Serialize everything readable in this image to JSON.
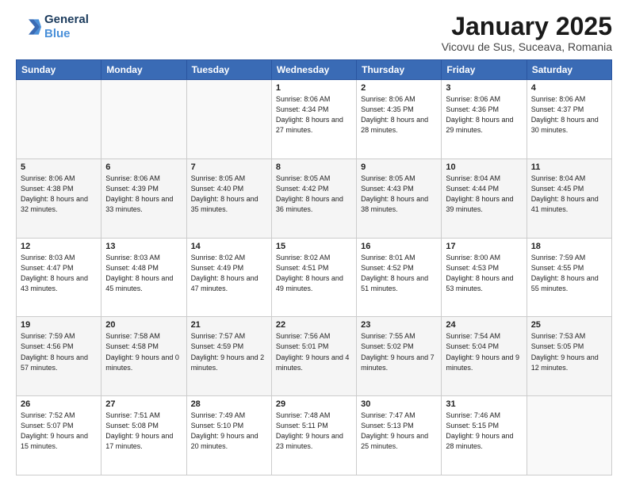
{
  "header": {
    "logo_line1": "General",
    "logo_line2": "Blue",
    "month": "January 2025",
    "location": "Vicovu de Sus, Suceava, Romania"
  },
  "days_of_week": [
    "Sunday",
    "Monday",
    "Tuesday",
    "Wednesday",
    "Thursday",
    "Friday",
    "Saturday"
  ],
  "weeks": [
    [
      {
        "day": "",
        "info": ""
      },
      {
        "day": "",
        "info": ""
      },
      {
        "day": "",
        "info": ""
      },
      {
        "day": "1",
        "info": "Sunrise: 8:06 AM\nSunset: 4:34 PM\nDaylight: 8 hours and 27 minutes."
      },
      {
        "day": "2",
        "info": "Sunrise: 8:06 AM\nSunset: 4:35 PM\nDaylight: 8 hours and 28 minutes."
      },
      {
        "day": "3",
        "info": "Sunrise: 8:06 AM\nSunset: 4:36 PM\nDaylight: 8 hours and 29 minutes."
      },
      {
        "day": "4",
        "info": "Sunrise: 8:06 AM\nSunset: 4:37 PM\nDaylight: 8 hours and 30 minutes."
      }
    ],
    [
      {
        "day": "5",
        "info": "Sunrise: 8:06 AM\nSunset: 4:38 PM\nDaylight: 8 hours and 32 minutes."
      },
      {
        "day": "6",
        "info": "Sunrise: 8:06 AM\nSunset: 4:39 PM\nDaylight: 8 hours and 33 minutes."
      },
      {
        "day": "7",
        "info": "Sunrise: 8:05 AM\nSunset: 4:40 PM\nDaylight: 8 hours and 35 minutes."
      },
      {
        "day": "8",
        "info": "Sunrise: 8:05 AM\nSunset: 4:42 PM\nDaylight: 8 hours and 36 minutes."
      },
      {
        "day": "9",
        "info": "Sunrise: 8:05 AM\nSunset: 4:43 PM\nDaylight: 8 hours and 38 minutes."
      },
      {
        "day": "10",
        "info": "Sunrise: 8:04 AM\nSunset: 4:44 PM\nDaylight: 8 hours and 39 minutes."
      },
      {
        "day": "11",
        "info": "Sunrise: 8:04 AM\nSunset: 4:45 PM\nDaylight: 8 hours and 41 minutes."
      }
    ],
    [
      {
        "day": "12",
        "info": "Sunrise: 8:03 AM\nSunset: 4:47 PM\nDaylight: 8 hours and 43 minutes."
      },
      {
        "day": "13",
        "info": "Sunrise: 8:03 AM\nSunset: 4:48 PM\nDaylight: 8 hours and 45 minutes."
      },
      {
        "day": "14",
        "info": "Sunrise: 8:02 AM\nSunset: 4:49 PM\nDaylight: 8 hours and 47 minutes."
      },
      {
        "day": "15",
        "info": "Sunrise: 8:02 AM\nSunset: 4:51 PM\nDaylight: 8 hours and 49 minutes."
      },
      {
        "day": "16",
        "info": "Sunrise: 8:01 AM\nSunset: 4:52 PM\nDaylight: 8 hours and 51 minutes."
      },
      {
        "day": "17",
        "info": "Sunrise: 8:00 AM\nSunset: 4:53 PM\nDaylight: 8 hours and 53 minutes."
      },
      {
        "day": "18",
        "info": "Sunrise: 7:59 AM\nSunset: 4:55 PM\nDaylight: 8 hours and 55 minutes."
      }
    ],
    [
      {
        "day": "19",
        "info": "Sunrise: 7:59 AM\nSunset: 4:56 PM\nDaylight: 8 hours and 57 minutes."
      },
      {
        "day": "20",
        "info": "Sunrise: 7:58 AM\nSunset: 4:58 PM\nDaylight: 9 hours and 0 minutes."
      },
      {
        "day": "21",
        "info": "Sunrise: 7:57 AM\nSunset: 4:59 PM\nDaylight: 9 hours and 2 minutes."
      },
      {
        "day": "22",
        "info": "Sunrise: 7:56 AM\nSunset: 5:01 PM\nDaylight: 9 hours and 4 minutes."
      },
      {
        "day": "23",
        "info": "Sunrise: 7:55 AM\nSunset: 5:02 PM\nDaylight: 9 hours and 7 minutes."
      },
      {
        "day": "24",
        "info": "Sunrise: 7:54 AM\nSunset: 5:04 PM\nDaylight: 9 hours and 9 minutes."
      },
      {
        "day": "25",
        "info": "Sunrise: 7:53 AM\nSunset: 5:05 PM\nDaylight: 9 hours and 12 minutes."
      }
    ],
    [
      {
        "day": "26",
        "info": "Sunrise: 7:52 AM\nSunset: 5:07 PM\nDaylight: 9 hours and 15 minutes."
      },
      {
        "day": "27",
        "info": "Sunrise: 7:51 AM\nSunset: 5:08 PM\nDaylight: 9 hours and 17 minutes."
      },
      {
        "day": "28",
        "info": "Sunrise: 7:49 AM\nSunset: 5:10 PM\nDaylight: 9 hours and 20 minutes."
      },
      {
        "day": "29",
        "info": "Sunrise: 7:48 AM\nSunset: 5:11 PM\nDaylight: 9 hours and 23 minutes."
      },
      {
        "day": "30",
        "info": "Sunrise: 7:47 AM\nSunset: 5:13 PM\nDaylight: 9 hours and 25 minutes."
      },
      {
        "day": "31",
        "info": "Sunrise: 7:46 AM\nSunset: 5:15 PM\nDaylight: 9 hours and 28 minutes."
      },
      {
        "day": "",
        "info": ""
      }
    ]
  ]
}
